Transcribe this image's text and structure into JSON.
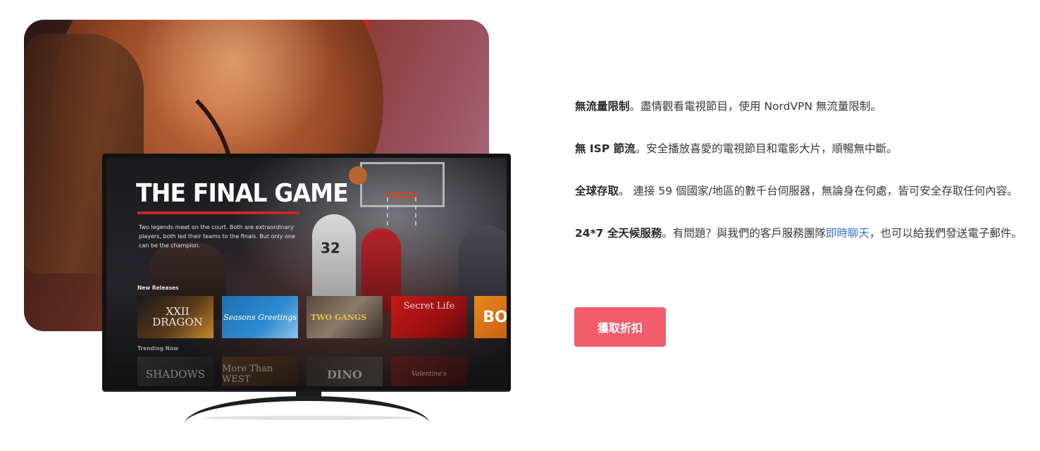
{
  "hero": {
    "tv_screen": {
      "title": "THE FINAL GAME",
      "description": "Two legends meet on the court. Both are extraordinary players, both led their teams to the finals. But only one can be the champion.",
      "player_number": "32",
      "rows": [
        {
          "label": "New Releases",
          "tiles": [
            "XXII DRAGON",
            "Seasons Greetings",
            "TWO GANGS",
            "Secret Life",
            "BO"
          ]
        },
        {
          "label": "Trending Now",
          "tiles": [
            "SHADOWS",
            "More Than WEST",
            "DINO",
            "Valentine's"
          ]
        }
      ]
    }
  },
  "features": [
    {
      "heading": "無流量限制",
      "text": "。盡情觀看電視節目，使用 NordVPN 無流量限制。"
    },
    {
      "heading": "無 ISP 節流",
      "text": "。安全播放喜愛的電視節目和電影大片，順暢無中斷。"
    },
    {
      "heading": "全球存取",
      "text": "。 連接 59 個國家/地區的數千台伺服器，無論身在何處，皆可安全存取任何內容。"
    },
    {
      "heading": "24*7 全天候服務",
      "text": "。有問題？與我們的客戶服務團隊",
      "link": "即時聊天",
      "text_after": "，也可以給我們發送電子郵件。"
    }
  ],
  "cta": {
    "label": "獲取折扣",
    "color": "#f25c6b"
  },
  "colors": {
    "link": "#3a6fd8",
    "title_bar": "#c8262c"
  }
}
